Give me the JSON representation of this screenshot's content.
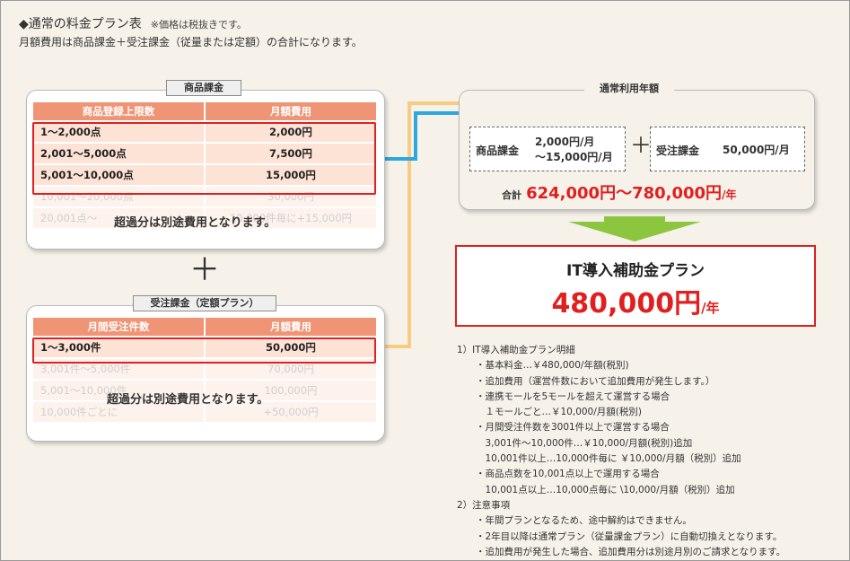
{
  "header": {
    "title": "◆通常の料金プラン表",
    "note": "※価格は税抜きです。",
    "subtitle": "月額費用は商品課金＋受注課金（従量または定額）の合計になります。"
  },
  "product_panel": {
    "label": "商品課金",
    "columns": [
      "商品登録上限数",
      "月額費用"
    ],
    "rows": [
      {
        "limit": "1〜2,000点",
        "fee": "2,000円"
      },
      {
        "limit": "2,001〜5,000点",
        "fee": "7,500円"
      },
      {
        "limit": "5,001〜10,000点",
        "fee": "15,000円"
      },
      {
        "limit": "10,001〜20,000点",
        "fee": "30,000円"
      },
      {
        "limit": "20,001点〜",
        "fee": "10,000件毎に+15,000円"
      }
    ],
    "overage_note": "超過分は別途費用となります。"
  },
  "plus_symbol": "＋",
  "order_panel": {
    "label": "受注課金（定額プラン）",
    "columns": [
      "月間受注件数",
      "月額費用"
    ],
    "rows": [
      {
        "limit": "1〜3,000件",
        "fee": "50,000円"
      },
      {
        "limit": "3,001件〜5,000件",
        "fee": "70,000円"
      },
      {
        "limit": "5,001〜10,000件",
        "fee": "100,000円"
      },
      {
        "limit": "10,000件ごとに",
        "fee": "+50,000円"
      }
    ],
    "overage_note": "超過分は別途費用となります。"
  },
  "annual_panel": {
    "label": "通常利用年額",
    "product_box": {
      "label": "商品課金",
      "value_line1": "2,000円/月",
      "value_line2": "〜15,000円/月"
    },
    "plus": "＋",
    "order_box": {
      "label": "受注課金",
      "value": "50,000円/月"
    },
    "total_label": "合計",
    "total_value": "624,000円〜780,000円",
    "total_unit": "/年"
  },
  "it_plan": {
    "title": "IT導入補助金プラン",
    "price": "480,000円",
    "unit": "/年"
  },
  "details": [
    "1）IT導入補助金プラン明細",
    "　　・基本料金…￥480,000/年額(税別)",
    "　　・追加費用（運営件数において追加費用が発生します。）",
    "　　・連携モールを5モールを超えて運営する場合",
    "　　　１モールごと…￥10,000/月額(税別)",
    "　　・月間受注件数を3001件以上で運営する場合",
    "　　　3,001件〜10,000件…￥10,000/月額(税別)追加",
    "　　　10,001件以上…10,000件毎に ￥10,000/月額（税別）追加",
    "　　・商品点数を10,001点以上で運用する場合",
    "　　　10,001点以上…10,000点毎に \\10,000/月額（税別）追加",
    "2）注意事項",
    "　　・年間プランとなるため、途中解約はできません。",
    "　　・2年目以降は通常プラン（従量課金プラン）に自動切換えとなります。",
    "　　・追加費用が発生した場合、追加費用分は別途月別のご請求となります。"
  ],
  "colors": {
    "header_cell": "#ef9474",
    "highlight_row": "#fde2d6",
    "faded_row": "#fdf2ec",
    "red": "#e02020",
    "blue_arrow": "#2ea6e0",
    "yellow_arrow": "#f8cc80",
    "green_arrow": "#8cc63f",
    "background": "#f6f2ea"
  }
}
